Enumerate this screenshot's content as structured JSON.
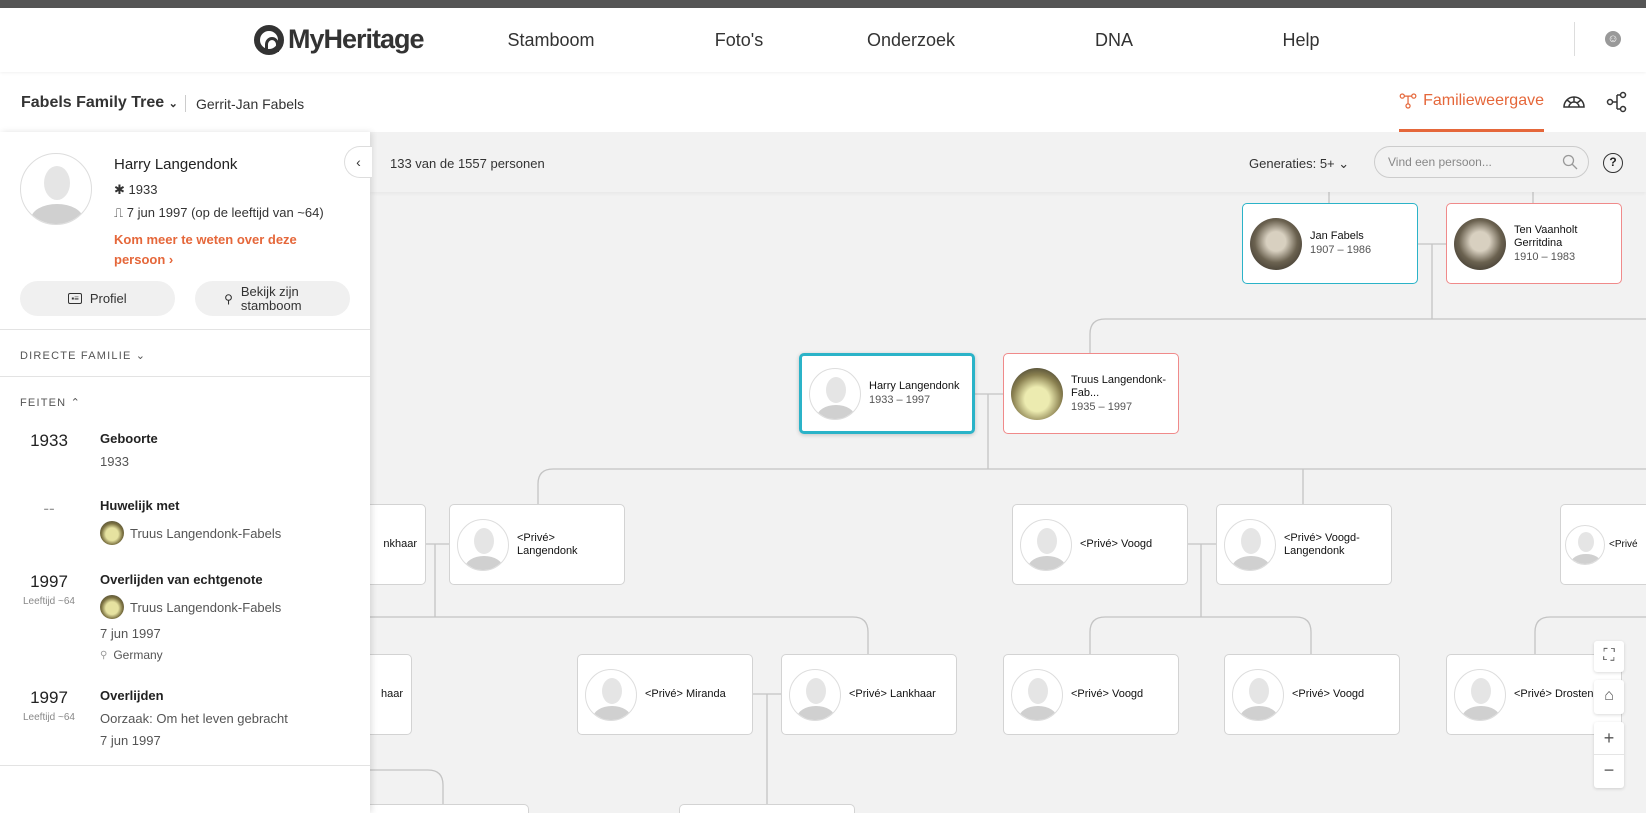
{
  "header": {
    "logo": "MyHeritage",
    "nav": [
      "Stamboom",
      "Foto's",
      "Onderzoek",
      "DNA",
      "Help"
    ]
  },
  "subheader": {
    "tree_name": "Fabels Family Tree",
    "owner": "Gerrit-Jan Fabels",
    "tab_active": "Familieweergave"
  },
  "panel": {
    "name": "Harry Langendonk",
    "birth": "1933",
    "death": "7 jun 1997 (op de leeftijd van ~64)",
    "learn_more": "Kom meer te weten over deze persoon ›",
    "profile_btn": "Profiel",
    "tree_btn": "Bekijk zijn stamboom",
    "direct_family": "DIRECTE FAMILIE",
    "facts_title": "FEITEN",
    "facts": [
      {
        "year": "1933",
        "age": "",
        "title": "Geboorte",
        "lines": [
          "1933"
        ]
      },
      {
        "year": "--",
        "age": "",
        "title": "Huwelijk met",
        "person": "Truus Langendonk-Fabels"
      },
      {
        "year": "1997",
        "age": "Leeftijd ~64",
        "title": "Overlijden van echtgenote",
        "person": "Truus Langendonk-Fabels",
        "date": "7 jun 1997",
        "place": "Germany"
      },
      {
        "year": "1997",
        "age": "Leeftijd ~64",
        "title": "Overlijden",
        "cause": "Oorzaak: Om het leven gebracht",
        "date": "7 jun 1997"
      }
    ]
  },
  "toolbar": {
    "count": "133 van de 1557 personen",
    "generations_label": "Generaties:",
    "generations_value": "5+",
    "search_placeholder": "Vind een persoon...",
    "help": "?"
  },
  "tree": {
    "jan": {
      "name": "Jan Fabels",
      "dates": "1907 – 1986"
    },
    "ten": {
      "name": "Ten Vaanholt Gerritdina",
      "dates": "1910 – 1983"
    },
    "harry": {
      "name": "Harry Langendonk",
      "dates": "1933 – 1997"
    },
    "truus": {
      "name": "Truus Langendonk-Fab...",
      "dates": "1935 – 1997"
    },
    "r3a": "nkhaar",
    "r3b": "<Privé> Langendonk",
    "r3c": "<Privé> Voogd",
    "r3d": "<Privé> Voogd-Langendonk",
    "r3e": "<Privé",
    "r4a": "haar",
    "r4b": "<Privé> Miranda",
    "r4c": "<Privé> Lankhaar",
    "r4d": "<Privé> Voogd",
    "r4e": "<Privé> Voogd",
    "r4f": "<Privé> Drosten"
  },
  "controls": {
    "zoom_in": "+",
    "zoom_out": "−"
  },
  "colors": {
    "accent": "#e5673a",
    "male": "#2bb3c8",
    "female": "#f08a8a"
  }
}
